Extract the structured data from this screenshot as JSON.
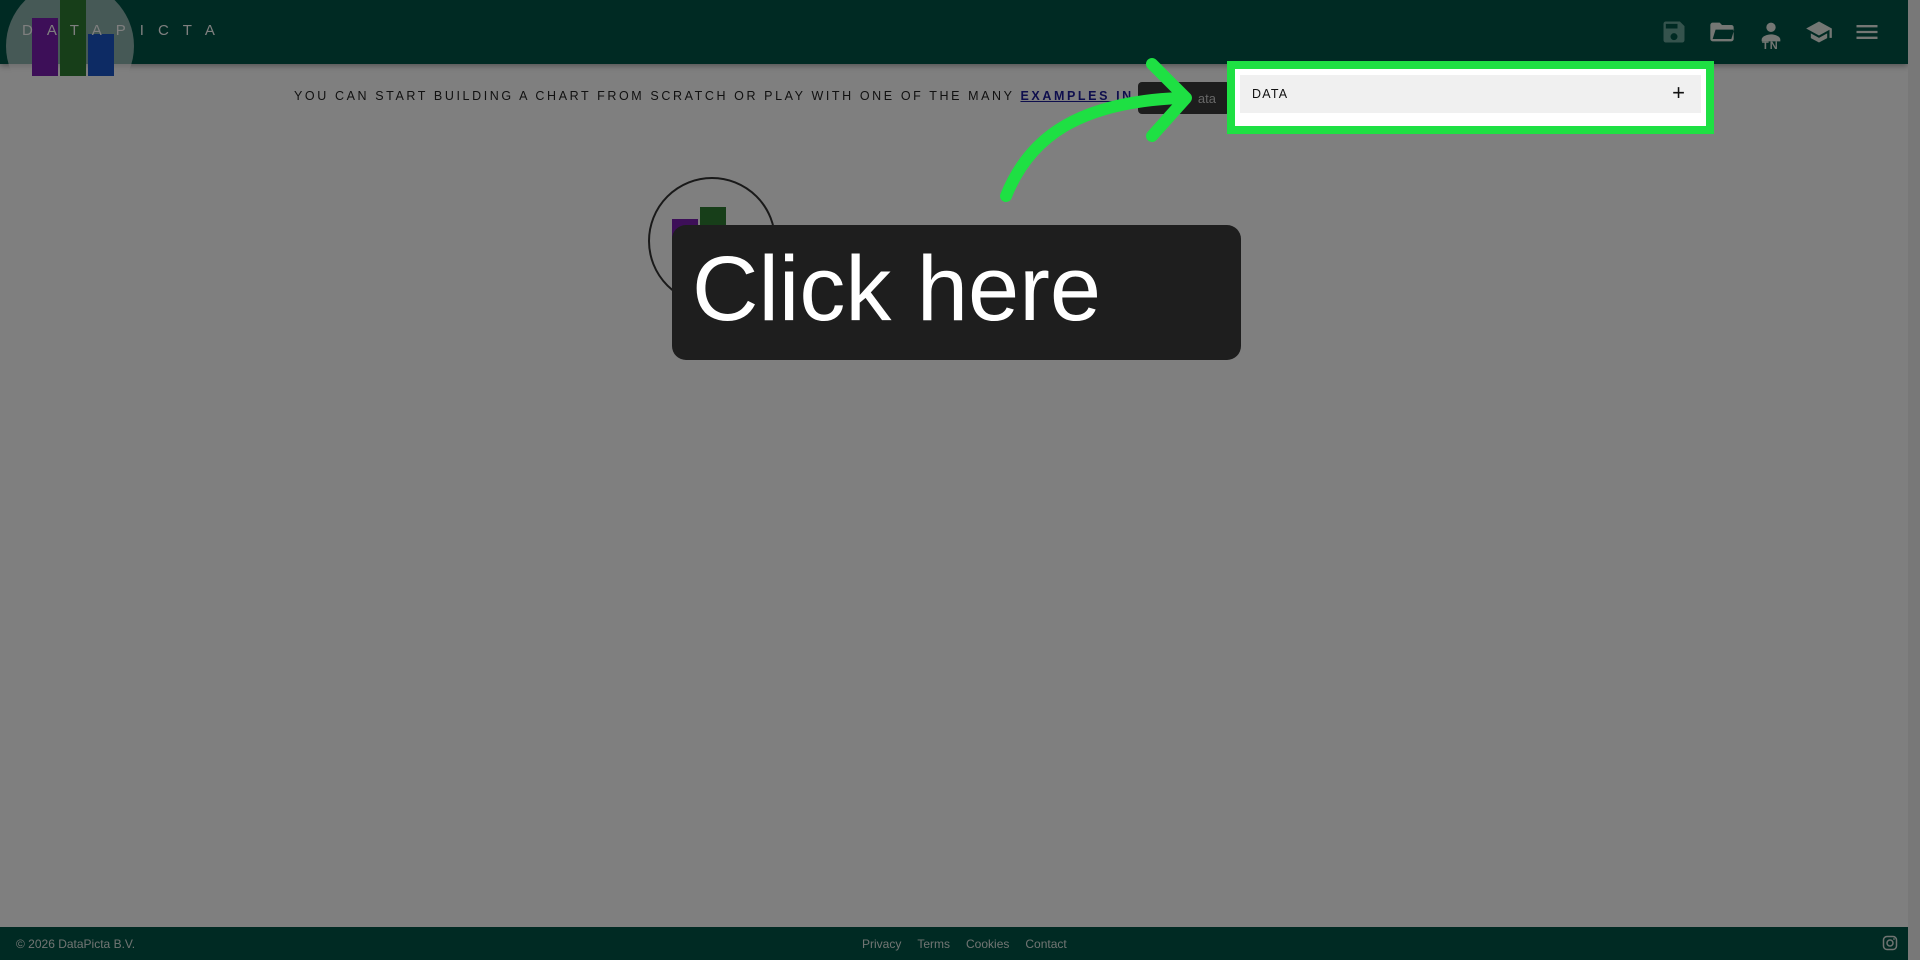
{
  "header": {
    "logo_text": "DATAPICTA",
    "user_initials": "TN",
    "icons": [
      "save-icon",
      "folder-open-icon",
      "user-icon",
      "graduation-cap-icon",
      "menu-icon"
    ]
  },
  "main": {
    "intro_text": "YOU CAN START BUILDING A CHART FROM SCRATCH OR PLAY WITH ONE OF THE MANY ",
    "intro_link": "EXAMPLES IN OUR LIBRARY",
    "load_button_label": "ata",
    "data_panel": {
      "label": "DATA",
      "toggle": "+"
    }
  },
  "overlay": {
    "callout_text": "Click here",
    "highlight_color": "#1ee043"
  },
  "footer": {
    "copyright": "© 2026 DataPicta B.V.",
    "links": [
      "Privacy",
      "Terms",
      "Cookies",
      "Contact"
    ],
    "social_icon": "instagram-icon"
  },
  "colors": {
    "brand": "#005547",
    "accent": "#1ee043",
    "callout_bg": "#1e1e1e"
  }
}
